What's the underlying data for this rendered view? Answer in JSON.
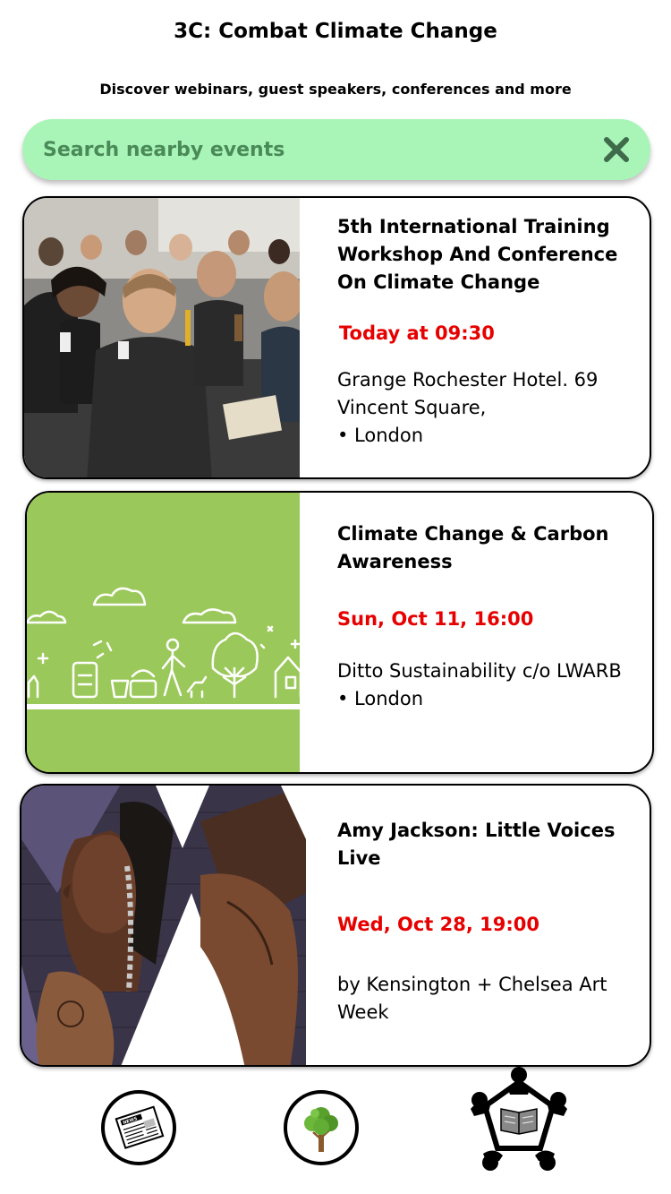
{
  "header": {
    "title": "3C: Combat Climate Change",
    "subtitle": "Discover webinars, guest speakers, conferences and more"
  },
  "search": {
    "placeholder": "Search nearby events",
    "value": "",
    "clear_icon": "close-icon"
  },
  "events": [
    {
      "title": "5th International Training Workshop And Conference On Climate Change",
      "time": "Today at 09:30",
      "location_line1": "Grange Rochester Hotel. 69 Vincent Square,",
      "location_line2": "• London",
      "image": "conference-audience-photo"
    },
    {
      "title": "Climate Change & Carbon Awareness",
      "time": "Sun, Oct 11, 16:00",
      "location_line1": "Ditto Sustainability c/o LWARB",
      "location_line2": "• London",
      "image": "sustainable-city-illustration"
    },
    {
      "title": "Amy Jackson: Little Voices Live",
      "time": "Wed, Oct 28, 19:00",
      "location_line1": "by Kensington + Chelsea Art Week",
      "location_line2": "",
      "image": "street-art-mural"
    }
  ],
  "bottom_nav": [
    {
      "icon": "newspaper-icon"
    },
    {
      "icon": "tree-icon"
    },
    {
      "icon": "community-reading-icon"
    }
  ],
  "colors": {
    "search_bg": "#a9f5b8",
    "time_red": "#e60000",
    "illustration_green": "#9bc85a"
  }
}
